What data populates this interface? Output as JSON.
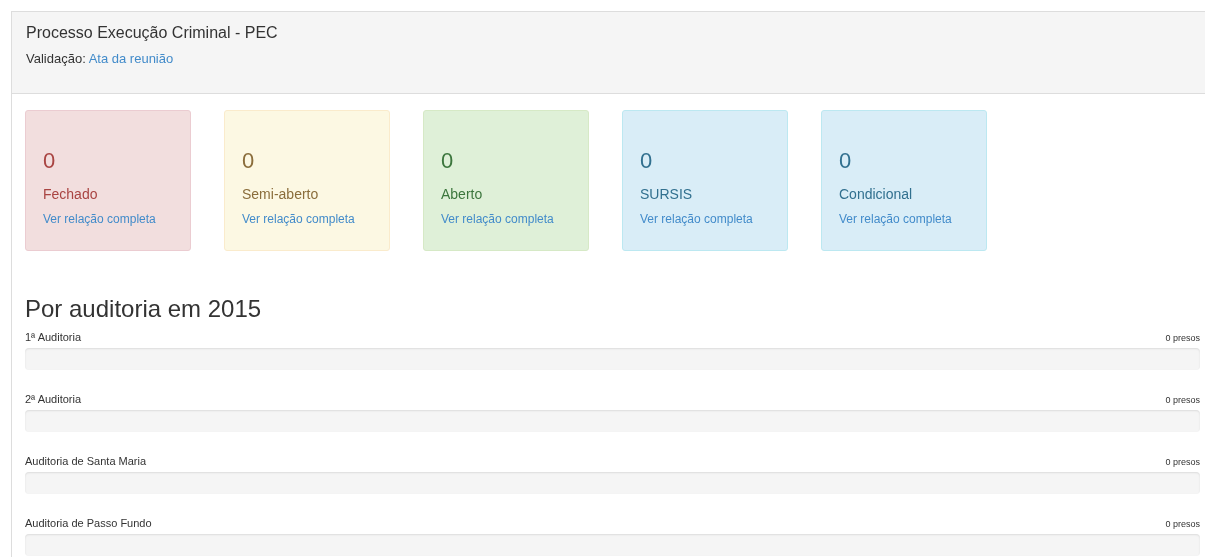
{
  "panel": {
    "title": "Processo Execução Criminal - PEC",
    "validation_label": "Validação:",
    "validation_link": "Ata da reunião"
  },
  "cards": [
    {
      "kind": "danger",
      "count": "0",
      "label": "Fechado",
      "link": "Ver relação completa"
    },
    {
      "kind": "warning",
      "count": "0",
      "label": "Semi-aberto",
      "link": "Ver relação completa"
    },
    {
      "kind": "success",
      "count": "0",
      "label": "Aberto",
      "link": "Ver relação completa"
    },
    {
      "kind": "info",
      "count": "0",
      "label": "SURSIS",
      "link": "Ver relação completa"
    },
    {
      "kind": "info",
      "count": "0",
      "label": "Condicional",
      "link": "Ver relação completa"
    }
  ],
  "section_title": "Por auditoria em 2015",
  "auditorias": [
    {
      "name": "1ª Auditoria",
      "reading": "0 presos",
      "level": 0
    },
    {
      "name": "2ª Auditoria",
      "reading": "0 presos",
      "level": 0
    },
    {
      "name": "Auditoria de Santa Maria",
      "reading": "0 presos",
      "level": 0
    },
    {
      "name": "Auditoria de Passo Fundo",
      "reading": "0 presos",
      "level": 0
    }
  ]
}
